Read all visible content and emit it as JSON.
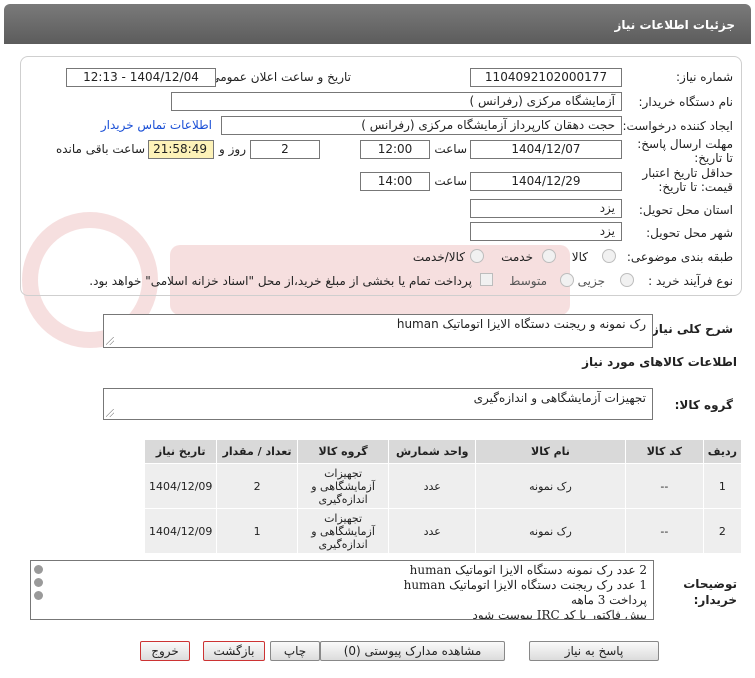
{
  "header": {
    "title": "جزئیات اطلاعات نیاز"
  },
  "form": {
    "need_number_label": "شماره نیاز:",
    "need_number": "1104092102000177",
    "announce_label": "تاریخ و ساعت اعلان عمومی:",
    "announce_value": "1404/12/04 - 12:13",
    "buyer_label": "نام دستگاه خریدار:",
    "buyer_value": "آزمایشگاه مرکزی (رفرانس )",
    "creator_label": "ایجاد کننده درخواست:",
    "creator_value": "حجت دهقان کارپرداز آزمایشگاه مرکزی (رفرانس )",
    "contact_link": "اطلاعات تماس خریدار",
    "deadline_label": "مهلت ارسال پاسخ: تا تاریخ:",
    "deadline_date": "1404/12/07",
    "time_label": "ساعت",
    "deadline_time": "12:00",
    "days_value": "2",
    "days_label": "روز و",
    "remaining_value": "21:58:49",
    "remaining_label": "ساعت باقی مانده",
    "validity_label": "حداقل تاریخ اعتبار قیمت: تا تاریخ:",
    "validity_date": "1404/12/29",
    "validity_time": "14:00",
    "province_label": "استان محل تحویل:",
    "province_value": "یزد",
    "city_label": "شهر محل تحویل:",
    "city_value": "یزد",
    "category_label": "طبقه بندی موضوعی:",
    "category_options": [
      "کالا",
      "خدمت",
      "کالا/خدمت"
    ],
    "process_label": "نوع فرآیند خرید :",
    "process_options": [
      "جزیی",
      "متوسط"
    ],
    "payment_note": "پرداخت تمام یا بخشی از مبلغ خرید،از محل \"اسناد خزانه اسلامی\" خواهد بود."
  },
  "description": {
    "label": "شرح کلی نیاز:",
    "value": "رک نمونه و ریجنت دستگاه الایزا اتوماتیک human"
  },
  "goods_info": {
    "title": "اطلاعات کالاهای مورد نیاز"
  },
  "goods_group": {
    "label": "گروه کالا:",
    "value": "تجهیزات آزمایشگاهی و اندازه‌گیری"
  },
  "table": {
    "headers": [
      "ردیف",
      "کد کالا",
      "نام کالا",
      "واحد شمارش",
      "گروه کالا",
      "تعداد / مقدار",
      "تاریخ نیاز"
    ],
    "rows": [
      [
        "1",
        "--",
        "رک نمونه",
        "عدد",
        "تجهیزات آزمایشگاهی و اندازه‌گیری",
        "2",
        "1404/12/09"
      ],
      [
        "2",
        "--",
        "رک نمونه",
        "عدد",
        "تجهیزات آزمایشگاهی و اندازه‌گیری",
        "1",
        "1404/12/09"
      ]
    ]
  },
  "notes": {
    "label": "توضیحات خریدار:",
    "lines": [
      "2 عدد رک نمونه دستگاه الایزا اتوماتیک human",
      "1 عدد رک ریجنت دستگاه الایزا اتوماتیک human",
      "پرداخت 3 ماهه",
      "پیش فاکتور با کد IRC پیوست شود"
    ]
  },
  "buttons": {
    "reply": "پاسخ به نیاز",
    "attachments": "مشاهده مدارک پیوستی (0)",
    "print": "چاپ",
    "back": "بازگشت",
    "exit": "خروج"
  },
  "colors": {
    "header": "#666666",
    "highlight": "#fdf2b8",
    "link": "#1a4fd6",
    "table_header": "#d9d9d9"
  }
}
